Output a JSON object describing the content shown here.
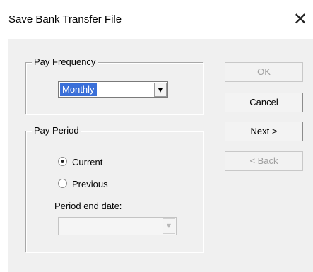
{
  "window": {
    "title": "Save Bank Transfer File",
    "close_glyph": "✕"
  },
  "pay_frequency": {
    "legend": "Pay Frequency",
    "selected": "Monthly",
    "arrow_glyph": "▼"
  },
  "pay_period": {
    "legend": "Pay Period",
    "options": [
      {
        "label": "Current",
        "checked": true
      },
      {
        "label": "Previous",
        "checked": false
      }
    ],
    "period_end_label": "Period end date:",
    "period_end_value": "",
    "arrow_glyph": "▼"
  },
  "buttons": {
    "ok": "OK",
    "cancel": "Cancel",
    "next": "Next >",
    "back": "< Back"
  }
}
